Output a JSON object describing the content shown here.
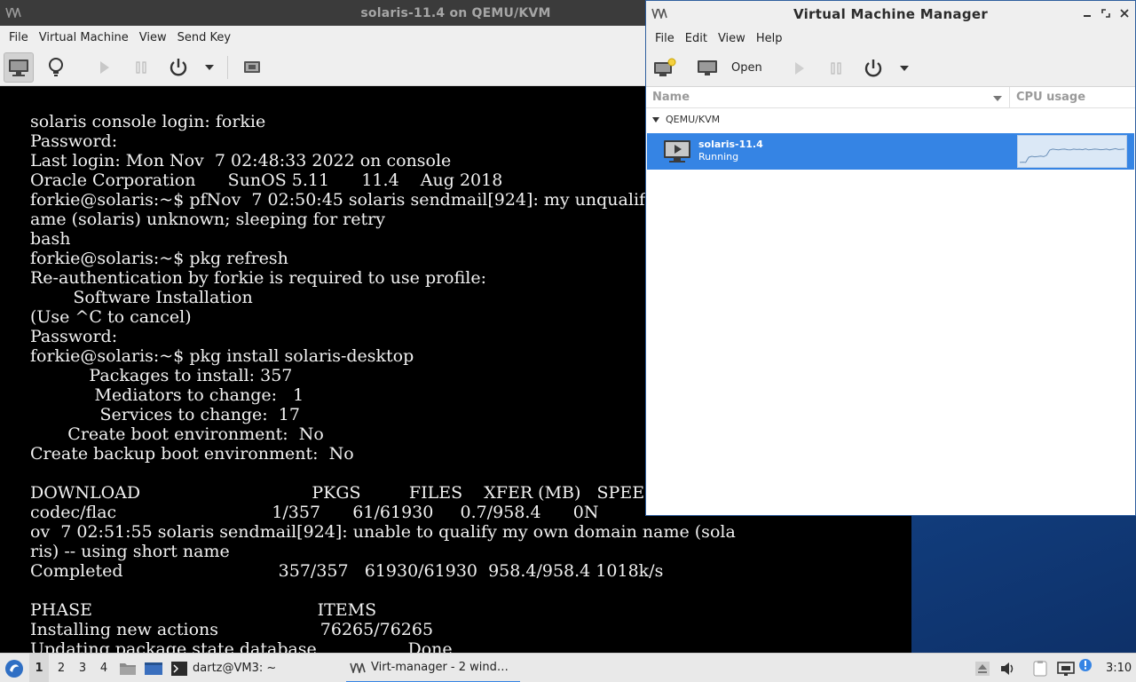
{
  "vm_window": {
    "title": "solaris-11.4 on QEMU/KVM",
    "menu": [
      "File",
      "Virtual Machine",
      "View",
      "Send Key"
    ],
    "console_lines": [
      "solaris console login: forkie",
      "Password:",
      "Last login: Mon Nov  7 02:48:33 2022 on console",
      "Oracle Corporation      SunOS 5.11      11.4    Aug 2018",
      "forkie@solaris:~$ pfNov  7 02:50:45 solaris sendmail[924]: my unqualified host n",
      "ame (solaris) unknown; sleeping for retry",
      "bash",
      "forkie@solaris:~$ pkg refresh",
      "Re-authentication by forkie is required to use profile:",
      "        Software Installation",
      "(Use ^C to cancel)",
      "Password:",
      "forkie@solaris:~$ pkg install solaris-desktop",
      "           Packages to install: 357",
      "            Mediators to change:   1",
      "             Services to change:  17",
      "       Create boot environment:  No",
      "Create backup boot environment:  No",
      "",
      "DOWNLOAD                                PKGS         FILES    XFER (MB)   SPEED",
      "codec/flac                             1/357      61/61930     0.7/958.4      0N",
      "ov  7 02:51:55 solaris sendmail[924]: unable to qualify my own domain name (sola",
      "ris) -- using short name",
      "Completed                             357/357   61930/61930  958.4/958.4 1018k/s",
      "",
      "PHASE                                          ITEMS",
      "Installing new actions                   76265/76265",
      "Updating package state database                 Done"
    ]
  },
  "vmm_window": {
    "title": "Virtual Machine Manager",
    "menu": [
      "File",
      "Edit",
      "View",
      "Help"
    ],
    "toolbar": {
      "open_label": "Open"
    },
    "columns": {
      "name": "Name",
      "cpu": "CPU usage"
    },
    "group": "QEMU/KVM",
    "vm": {
      "name": "solaris-11.4",
      "status": "Running"
    },
    "cpu_usage_samples": [
      0.05,
      0.06,
      0.05,
      0.3,
      0.35,
      0.32,
      0.34,
      0.36,
      0.33,
      0.4,
      0.65,
      0.7,
      0.68,
      0.66,
      0.69,
      0.7,
      0.67,
      0.66,
      0.7,
      0.68,
      0.69,
      0.67,
      0.71,
      0.66,
      0.68,
      0.7,
      0.69,
      0.67,
      0.68,
      0.7,
      0.66,
      0.69,
      0.72,
      0.68,
      0.69,
      0.7
    ]
  },
  "taskbar": {
    "workspaces": [
      "1",
      "2",
      "3",
      "4"
    ],
    "active_workspace": "1",
    "terminal_task": "dartz@VM3: ~",
    "virt_task": "Virt-manager - 2 wind…",
    "clock": "3:10"
  },
  "colors": {
    "accent": "#3584e4",
    "console_bg": "#000000",
    "titlebar_dark": "#3b3b3b"
  }
}
